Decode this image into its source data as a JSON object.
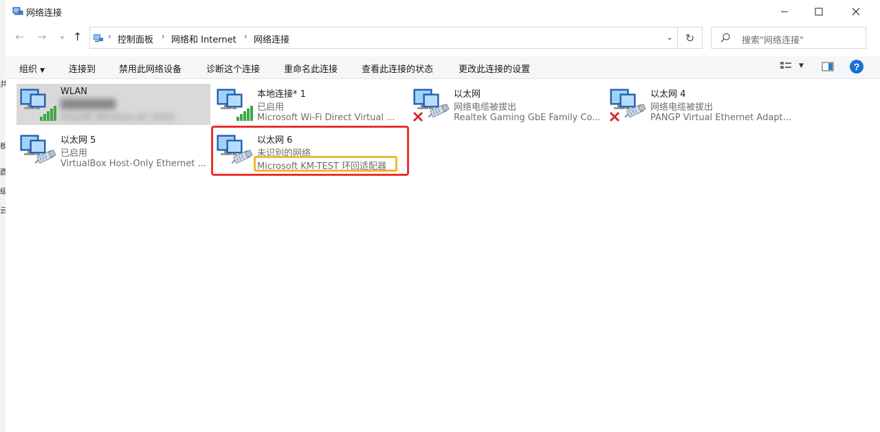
{
  "window": {
    "title": "网络连接"
  },
  "address": {
    "crumbs": [
      "控制面板",
      "网络和 Internet",
      "网络连接"
    ]
  },
  "search": {
    "placeholder": "搜索\"网络连接\""
  },
  "toolbar": {
    "organize": "组织",
    "connect": "连接到",
    "disable": "禁用此网络设备",
    "diagnose": "诊断这个连接",
    "rename": "重命名此连接",
    "view_status": "查看此连接的状态",
    "change_settings": "更改此连接的设置"
  },
  "connections": [
    {
      "name": "WLAN",
      "status": "",
      "device": "Intel(R) Wireless-AC 9560",
      "type": "wifi",
      "selected": true
    },
    {
      "name": "本地连接* 1",
      "status": "已启用",
      "device": "Microsoft Wi-Fi Direct Virtual ...",
      "type": "wifi"
    },
    {
      "name": "以太网",
      "status": "网络电缆被拔出",
      "device": "Realtek Gaming GbE Family Co...",
      "type": "ethernet-disconnected"
    },
    {
      "name": "以太网 4",
      "status": "网络电缆被拔出",
      "device": "PANGP Virtual Ethernet Adapt...",
      "type": "ethernet-disconnected"
    },
    {
      "name": "以太网 5",
      "status": "已启用",
      "device": "VirtualBox Host-Only Ethernet ...",
      "type": "ethernet"
    },
    {
      "name": "以太网 6",
      "status": "未识别的网络",
      "device": "Microsoft KM-TEST 环回适配器",
      "type": "ethernet",
      "highlighted": true
    }
  ],
  "colors": {
    "highlight_red": "#e8312e",
    "highlight_yellow": "#f2b731",
    "selected_bg": "#d9d9d9"
  }
}
